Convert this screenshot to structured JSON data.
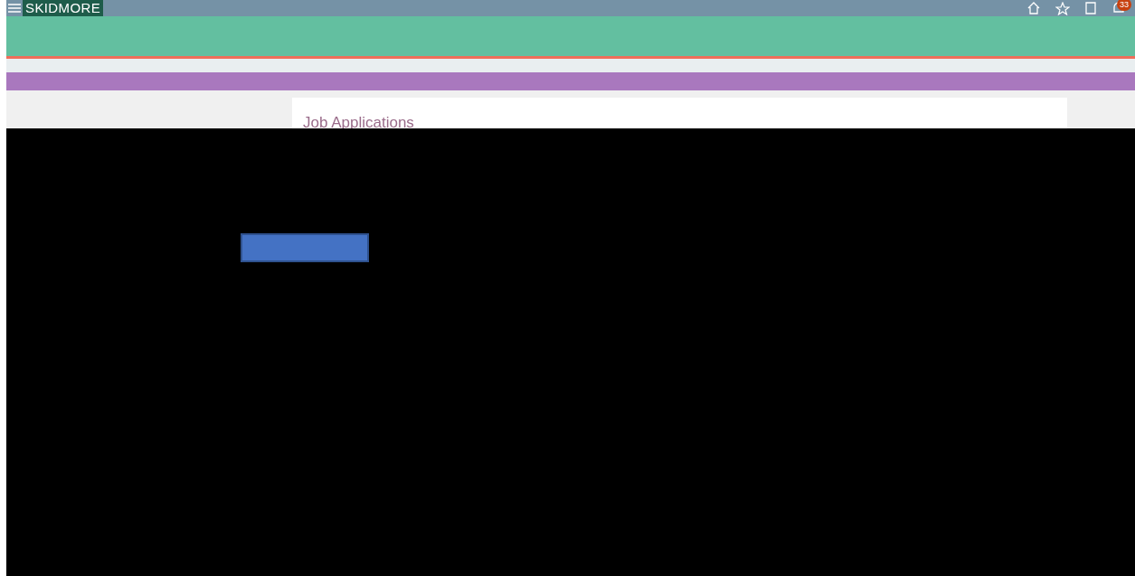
{
  "header": {
    "logo": "SKIDMORE",
    "notifications": {
      "count": "33"
    }
  },
  "content": {
    "title": "Job Applications"
  }
}
